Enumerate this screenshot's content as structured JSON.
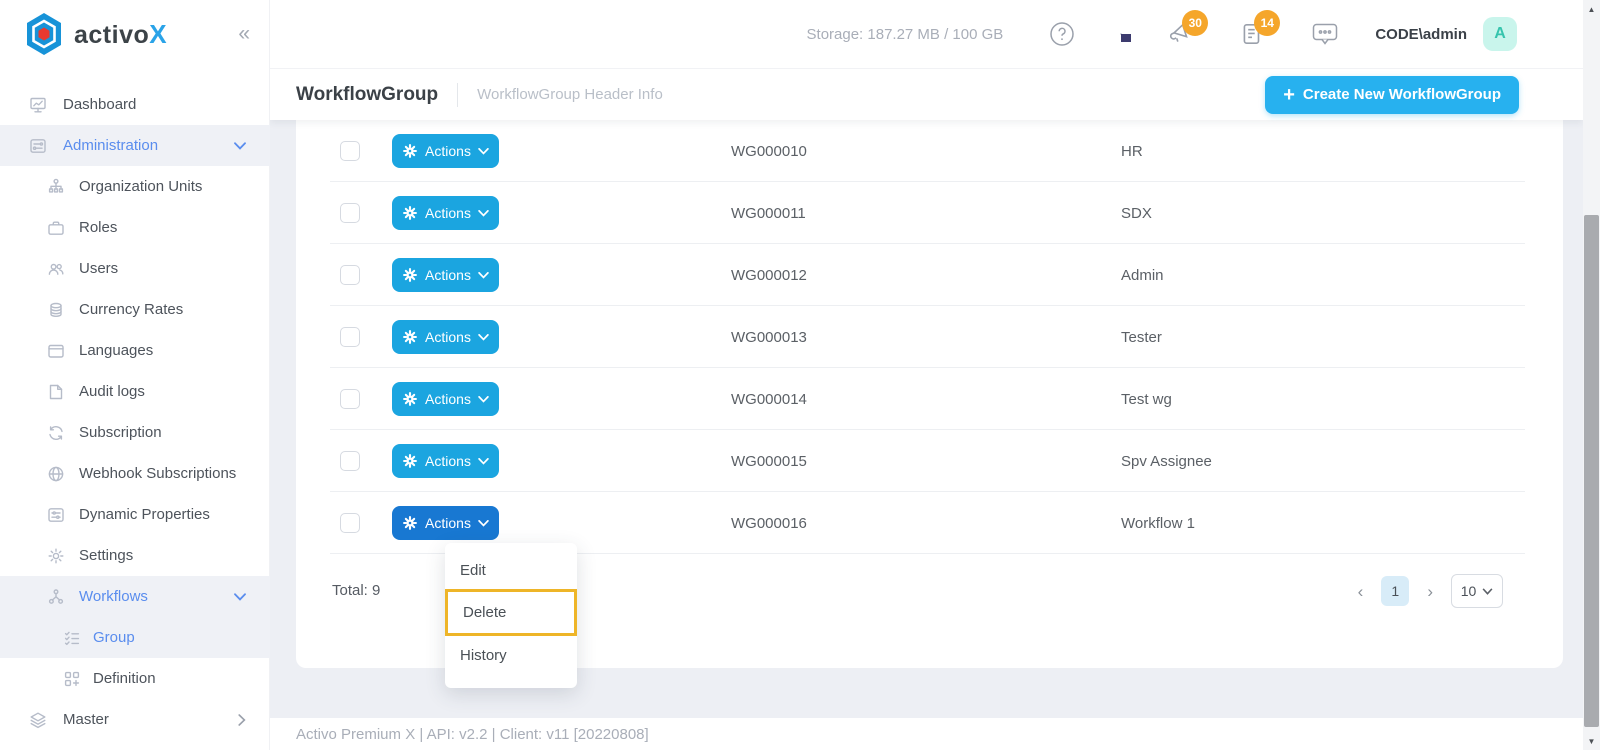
{
  "brand": {
    "name": "activo",
    "x": "X"
  },
  "topbar": {
    "storage": "Storage: 187.27 MB / 100 GB",
    "announcement_badge": "30",
    "notes_badge": "14",
    "user": "CODE\\admin",
    "avatar_initial": "A"
  },
  "page_header": {
    "title": "WorkflowGroup",
    "subtitle": "WorkflowGroup Header Info",
    "create_button": "Create New WorkflowGroup"
  },
  "sidebar": {
    "items": [
      {
        "label": "Dashboard",
        "icon": "dashboard-icon",
        "level": 1,
        "active": false,
        "chevron": null
      },
      {
        "label": "Administration",
        "icon": "administration-icon",
        "level": 1,
        "active": true,
        "chevron": "down"
      },
      {
        "label": "Organization Units",
        "icon": "org-units-icon",
        "level": 2,
        "active": false,
        "chevron": null
      },
      {
        "label": "Roles",
        "icon": "roles-icon",
        "level": 2,
        "active": false,
        "chevron": null
      },
      {
        "label": "Users",
        "icon": "users-icon",
        "level": 2,
        "active": false,
        "chevron": null
      },
      {
        "label": "Currency Rates",
        "icon": "currency-icon",
        "level": 2,
        "active": false,
        "chevron": null
      },
      {
        "label": "Languages",
        "icon": "languages-icon",
        "level": 2,
        "active": false,
        "chevron": null
      },
      {
        "label": "Audit logs",
        "icon": "audit-logs-icon",
        "level": 2,
        "active": false,
        "chevron": null
      },
      {
        "label": "Subscription",
        "icon": "subscription-icon",
        "level": 2,
        "active": false,
        "chevron": null
      },
      {
        "label": "Webhook Subscriptions",
        "icon": "webhook-icon",
        "level": 2,
        "active": false,
        "chevron": null
      },
      {
        "label": "Dynamic Properties",
        "icon": "dynamic-props-icon",
        "level": 2,
        "active": false,
        "chevron": null
      },
      {
        "label": "Settings",
        "icon": "settings-icon",
        "level": 2,
        "active": false,
        "chevron": null
      },
      {
        "label": "Workflows",
        "icon": "workflows-icon",
        "level": 2,
        "active": true,
        "chevron": "down"
      },
      {
        "label": "Group",
        "icon": "group-icon",
        "level": 3,
        "active": true,
        "chevron": null
      },
      {
        "label": "Definition",
        "icon": "definition-icon",
        "level": 3,
        "active": false,
        "chevron": null
      },
      {
        "label": "Master",
        "icon": "master-icon",
        "level": 1,
        "active": false,
        "chevron": "right"
      }
    ]
  },
  "table": {
    "actions_label": "Actions",
    "rows": [
      {
        "code": "WG000010",
        "name": "HR",
        "active": false
      },
      {
        "code": "WG000011",
        "name": "SDX",
        "active": false
      },
      {
        "code": "WG000012",
        "name": "Admin",
        "active": false
      },
      {
        "code": "WG000013",
        "name": "Tester",
        "active": false
      },
      {
        "code": "WG000014",
        "name": "Test wg",
        "active": false
      },
      {
        "code": "WG000015",
        "name": "Spv Assignee",
        "active": false
      },
      {
        "code": "WG000016",
        "name": "Workflow 1",
        "active": true
      }
    ],
    "total": "Total: 9"
  },
  "context_menu": {
    "items": [
      {
        "label": "Edit",
        "highlighted": false
      },
      {
        "label": "Delete",
        "highlighted": true
      },
      {
        "label": "History",
        "highlighted": false
      }
    ]
  },
  "pagination": {
    "current_page": "1",
    "page_size": "10"
  },
  "footer": {
    "text": "Activo Premium X | API: v2.2 | Client: v11 [20220808]"
  },
  "colors": {
    "actions_blue": "#1ba5e0",
    "actions_active_blue": "#1878d2",
    "create_blue": "#27b1ef",
    "sidebar_active_blue": "#5a8dee",
    "highlight_yellow": "#eeb528",
    "badge_orange": "#f5a62b",
    "avatar_bg": "#c9f5ec",
    "avatar_text": "#35c4ad"
  }
}
